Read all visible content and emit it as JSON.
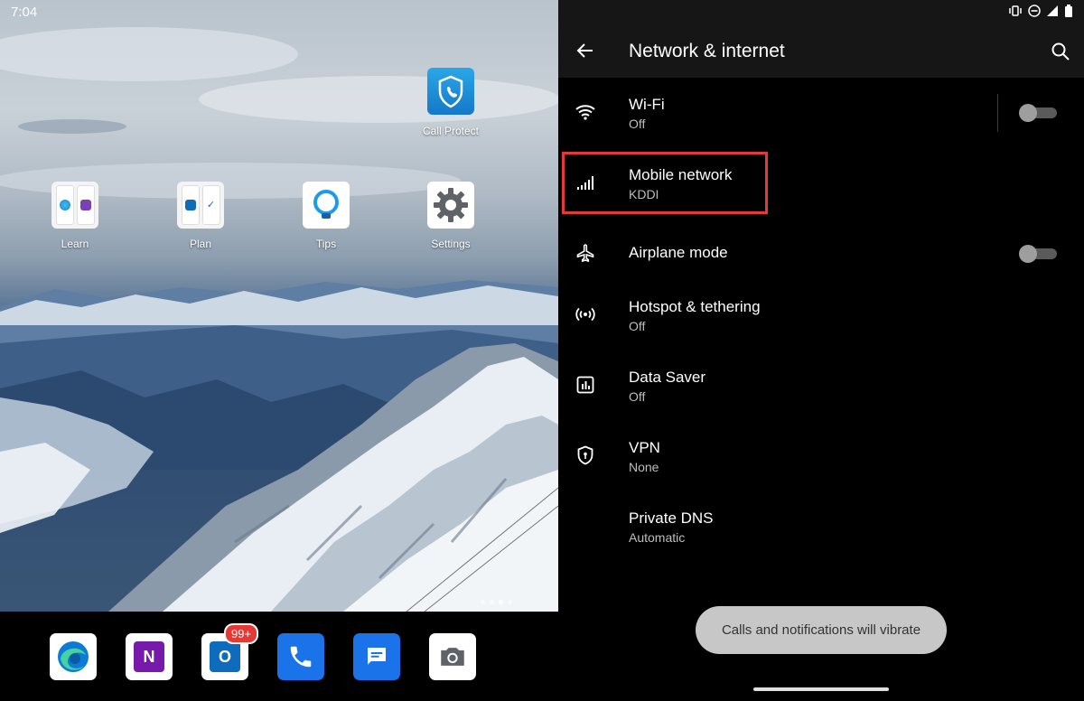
{
  "home": {
    "clock": "7:04",
    "apps": [
      {
        "label": "Call Protect",
        "icon": "call-protect-shield-icon"
      },
      {
        "label": "Learn",
        "icon": "folder-edge-onenote-icon"
      },
      {
        "label": "Plan",
        "icon": "folder-outlook-todo-icon"
      },
      {
        "label": "Tips",
        "icon": "lightbulb-icon"
      },
      {
        "label": "Settings",
        "icon": "gear-icon"
      }
    ],
    "dock": [
      {
        "name": "edge",
        "icon": "edge-icon"
      },
      {
        "name": "onenote",
        "icon": "onenote-icon",
        "glyph": "N"
      },
      {
        "name": "outlook",
        "icon": "outlook-icon",
        "glyph": "O",
        "badge": "99+"
      },
      {
        "name": "phone",
        "icon": "phone-icon"
      },
      {
        "name": "messages",
        "icon": "messages-icon"
      },
      {
        "name": "camera",
        "icon": "camera-icon"
      }
    ],
    "page_indicator": {
      "pages": 4,
      "current": 3
    }
  },
  "settings": {
    "title": "Network & internet",
    "items": [
      {
        "title": "Wi-Fi",
        "subtitle": "Off",
        "icon": "wifi-icon",
        "toggle": false
      },
      {
        "title": "Mobile network",
        "subtitle": "KDDI",
        "icon": "signal-icon"
      },
      {
        "title": "Airplane mode",
        "icon": "airplane-icon",
        "toggle": false
      },
      {
        "title": "Hotspot & tethering",
        "subtitle": "Off",
        "icon": "hotspot-icon"
      },
      {
        "title": "Data Saver",
        "subtitle": "Off",
        "icon": "data-saver-icon"
      },
      {
        "title": "VPN",
        "subtitle": "None",
        "icon": "vpn-shield-icon"
      },
      {
        "title": "Private DNS",
        "subtitle": "Automatic"
      }
    ],
    "toast": "Calls and notifications will vibrate"
  },
  "colors": {
    "highlight": "#e53935",
    "appbar": "#161616",
    "toast_bg": "#c7c7c7"
  }
}
